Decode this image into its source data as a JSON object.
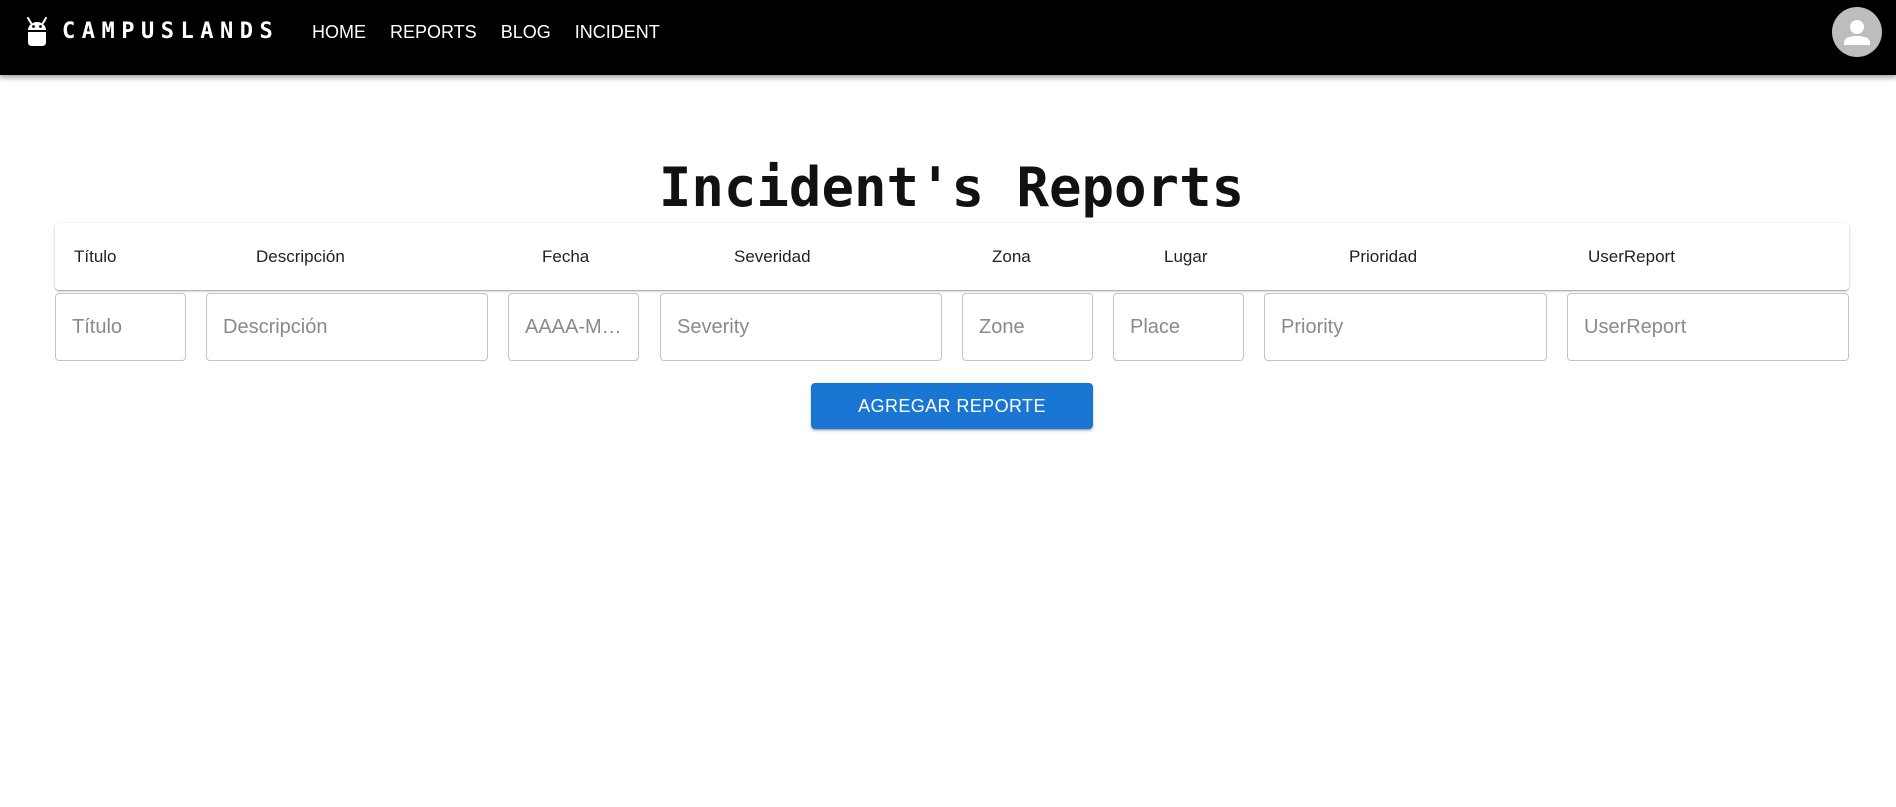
{
  "brand": {
    "name": "CAMPUSLANDS",
    "icon": "android-icon"
  },
  "nav": {
    "items": [
      {
        "label": "HOME"
      },
      {
        "label": "REPORTS"
      },
      {
        "label": "BLOG"
      },
      {
        "label": "INCIDENT"
      }
    ]
  },
  "user": {
    "avatar_icon": "person-icon"
  },
  "page": {
    "title": "Incident's Reports"
  },
  "table": {
    "headers": [
      "Título",
      "Descripción",
      "Fecha",
      "Severidad",
      "Zona",
      "Lugar",
      "Prioridad",
      "UserReport"
    ]
  },
  "form": {
    "fields": [
      {
        "placeholder": "Título"
      },
      {
        "placeholder": "Descripción"
      },
      {
        "placeholder": "AAAA-M…"
      },
      {
        "placeholder": "Severity"
      },
      {
        "placeholder": "Zone"
      },
      {
        "placeholder": "Place"
      },
      {
        "placeholder": "Priority"
      },
      {
        "placeholder": "UserReport"
      }
    ],
    "submit_label": "AGREGAR REPORTE"
  },
  "colors": {
    "appbar": "#000000",
    "primary": "#1976d2",
    "avatar_bg": "#bdbdbd"
  }
}
